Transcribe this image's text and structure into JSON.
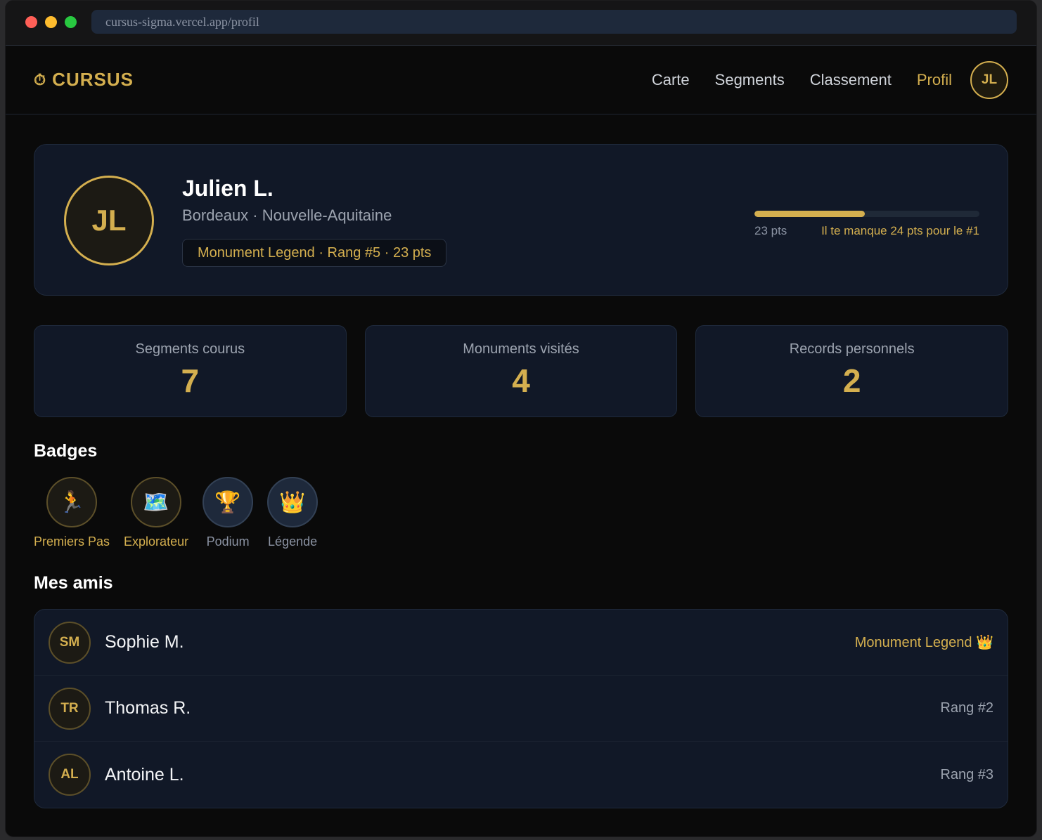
{
  "browser": {
    "url": "cursus-sigma.vercel.app/profil"
  },
  "nav": {
    "brand_icon": "⏱",
    "brand": "CURSUS",
    "links": [
      "Carte",
      "Segments",
      "Classement",
      "Profil"
    ],
    "active_link": "Profil",
    "avatar_initials": "JL"
  },
  "profile": {
    "initials": "JL",
    "name": "Julien L.",
    "location": "Bordeaux · Nouvelle-Aquitaine",
    "pill": "Monument Legend · Rang #5 · 23 pts",
    "progress_fraction": 0.49,
    "progress_points": "23 pts",
    "progress_missing": "Il te manque 24 pts pour le #1"
  },
  "stats": [
    {
      "label": "Segments courus",
      "value": "7"
    },
    {
      "label": "Monuments visités",
      "value": "4"
    },
    {
      "label": "Records personnels",
      "value": "2"
    }
  ],
  "badges": {
    "title": "Badges",
    "items": [
      {
        "icon": "🏃",
        "icon_name": "runner-icon",
        "label": "Premiers Pas",
        "earned": true
      },
      {
        "icon": "🗺️",
        "icon_name": "map-icon",
        "label": "Explorateur",
        "earned": true
      },
      {
        "icon": "🏆",
        "icon_name": "trophy-icon",
        "label": "Podium",
        "earned": false
      },
      {
        "icon": "👑",
        "icon_name": "crown-icon",
        "label": "Légende",
        "earned": false
      }
    ]
  },
  "friends": {
    "title": "Mes amis",
    "items": [
      {
        "initials": "SM",
        "name": "Sophie M.",
        "status": "Monument Legend 👑",
        "highlight": true
      },
      {
        "initials": "TR",
        "name": "Thomas R.",
        "status": "Rang #2",
        "highlight": false
      },
      {
        "initials": "AL",
        "name": "Antoine L.",
        "status": "Rang #3",
        "highlight": false
      }
    ]
  },
  "colors": {
    "accent": "#d4af4f",
    "background": "#0a0a0a",
    "card": "#111827"
  }
}
